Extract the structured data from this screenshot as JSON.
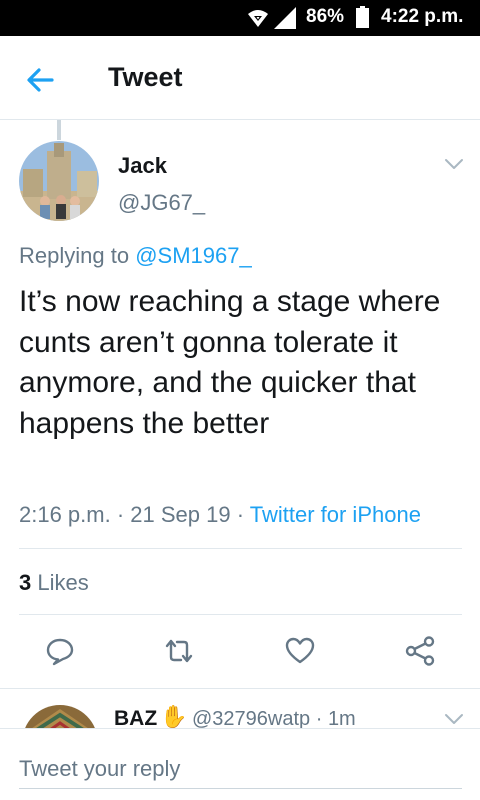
{
  "status_bar": {
    "battery_percent": "86%",
    "time": "4:22 p.m."
  },
  "header": {
    "title": "Tweet",
    "back_icon": "arrow-left-icon"
  },
  "tweet": {
    "author_name": "Jack",
    "author_handle": "@JG67_",
    "replying_prefix": "Replying to",
    "replying_to": "@SM1967_",
    "text": "It’s now reaching a stage where cunts aren’t gonna tolerate it anymore, and the quicker that happens the better",
    "time": "2:16 p.m.",
    "date": "21 Sep 19",
    "source": "Twitter for iPhone",
    "likes_count": "3",
    "likes_label": "Likes"
  },
  "actions": [
    "reply-icon",
    "retweet-icon",
    "like-icon",
    "share-icon"
  ],
  "next_reply": {
    "author_name": "BAZ",
    "emoji": "✋",
    "handle_time": "@32796watp · 1m"
  },
  "reply_box": {
    "placeholder": "Tweet your reply"
  },
  "colors": {
    "accent": "#1da1f2",
    "text": "#14171a",
    "secondary": "#657786",
    "divider": "#e1e8ed"
  }
}
